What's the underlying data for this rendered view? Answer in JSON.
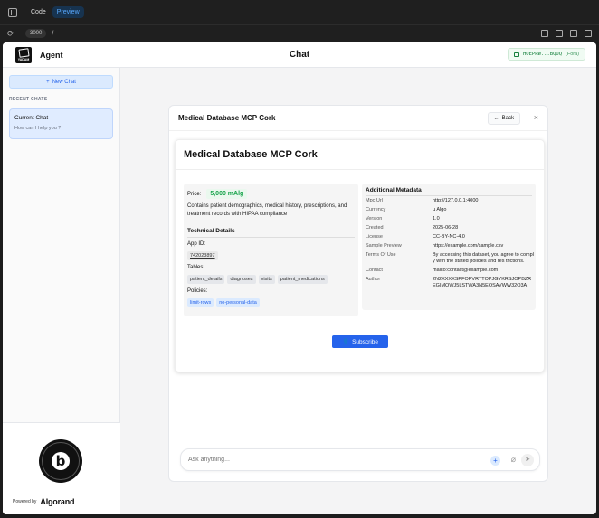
{
  "browser": {
    "tabs": [
      {
        "label": "Code"
      },
      {
        "label": "Preview"
      }
    ],
    "port": "3000",
    "path": "/"
  },
  "header": {
    "logo_text": "YADAM",
    "agent_label": "Agent",
    "title": "Chat",
    "wallet": "HOEPRW...BQUQ",
    "network": "(Fora)"
  },
  "sidebar": {
    "new_chat": "New Chat",
    "recent_label": "RECENT CHATS",
    "chats": [
      {
        "title": "Current Chat",
        "subtitle": "How can I help you ?"
      }
    ],
    "powered_by": "Powered by",
    "brand": "Algorand"
  },
  "panel": {
    "title": "Medical Database MCP Cork",
    "back": "Back",
    "close": "×",
    "card_title": "Medical Database MCP Cork",
    "price_label": "Price:",
    "price": "5,000 mAlg",
    "description": "Contains patient demographics, medical history, prescriptions, and treatment records with HIPAA compliance",
    "tech_heading": "Technical Details",
    "app_id_label": "App ID:",
    "app_id": "742023897",
    "tables_label": "Tables:",
    "tables": [
      "patient_details",
      "diagnoses",
      "visits",
      "patient_medications"
    ],
    "policies_label": "Policies:",
    "policies": [
      "limit-rows",
      "no-personal-data"
    ],
    "meta_heading": "Additional Metadata",
    "metadata": [
      {
        "k": "Mpc Url",
        "v": "http://127.0.0.1:4000"
      },
      {
        "k": "Currency",
        "v": "µ Algo"
      },
      {
        "k": "Version",
        "v": "1.0"
      },
      {
        "k": "Created",
        "v": "2025-06-28"
      },
      {
        "k": "License",
        "v": "CC-BY-NC-4.0"
      },
      {
        "k": "Sample Preview",
        "v": "https://example.com/sample.csv"
      },
      {
        "k": "Terms Of Use",
        "v": "By accessing this dataset, you agree to comply with the stated policies and res trictions."
      },
      {
        "k": "Contact",
        "v": "mailto:contact@example.com"
      },
      {
        "k": "Author",
        "v": "2N2XXXXSPFOPVRTTOPJGYKRSJOPBZREGIMQWJ5LSTWA3N5EQSAVWW32Q3A"
      }
    ],
    "subscribe": "Subscribe"
  },
  "composer": {
    "placeholder": "Ask anything..."
  }
}
